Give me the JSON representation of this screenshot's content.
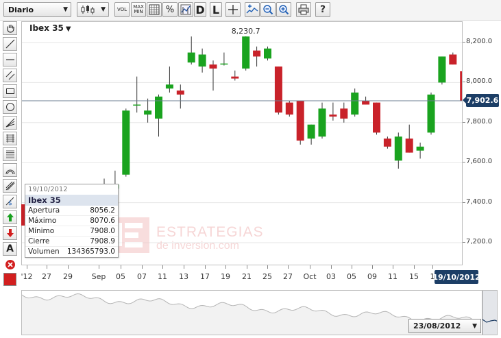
{
  "toolbar": {
    "period_label": "Diario",
    "vol_label": "VOL",
    "maxmin_label_top": "MAX",
    "maxmin_label_bottom": "MIN",
    "percent_label": "%",
    "daily_label": "D",
    "log_label": "L",
    "help_label": "?"
  },
  "chart": {
    "instrument": "Ibex 35",
    "max_label": "8,230.7",
    "current_price_tag": "7,902.6",
    "current_date_tag": "19/10/2012",
    "y_ticks": [
      "8,200.0",
      "8,000.0",
      "7,800.0",
      "7,600.0",
      "7,400.0",
      "7,200.0"
    ],
    "x_ticks": [
      "'12",
      "27",
      "29",
      "Sep",
      "05",
      "07",
      "11",
      "13",
      "17",
      "19",
      "21",
      "25",
      "27",
      "Oct",
      "03",
      "05",
      "09",
      "11",
      "15",
      "1"
    ],
    "up_color": "#1aa31f",
    "down_color": "#c9222a"
  },
  "chart_data": {
    "type": "candlestick",
    "title": "Ibex 35",
    "ylim": [
      7100,
      8300
    ],
    "y_ticks": [
      8200,
      8000,
      7800,
      7600,
      7400,
      7200
    ],
    "candles": [
      {
        "o": 7440,
        "h": 7520,
        "l": 7390,
        "c": 7460
      },
      {
        "o": 7470,
        "h": 7560,
        "l": 7420,
        "c": 7490
      },
      {
        "o": 7540,
        "h": 7870,
        "l": 7530,
        "c": 7860
      },
      {
        "o": 7885,
        "h": 8030,
        "l": 7850,
        "c": 7890
      },
      {
        "o": 7840,
        "h": 7920,
        "l": 7800,
        "c": 7860
      },
      {
        "o": 7820,
        "h": 7940,
        "l": 7730,
        "c": 7930
      },
      {
        "o": 7970,
        "h": 8080,
        "l": 7950,
        "c": 7990
      },
      {
        "o": 7960,
        "h": 7990,
        "l": 7870,
        "c": 7940
      },
      {
        "o": 8100,
        "h": 8230,
        "l": 8090,
        "c": 8150
      },
      {
        "o": 8080,
        "h": 8170,
        "l": 8050,
        "c": 8140
      },
      {
        "o": 8090,
        "h": 8110,
        "l": 7960,
        "c": 8070
      },
      {
        "o": 8090,
        "h": 8150,
        "l": 8085,
        "c": 8095
      },
      {
        "o": 8030,
        "h": 8060,
        "l": 8010,
        "c": 8020
      },
      {
        "o": 8070,
        "h": 8230.7,
        "l": 8060,
        "c": 8230
      },
      {
        "o": 8160,
        "h": 8180,
        "l": 8080,
        "c": 8130
      },
      {
        "o": 8120,
        "h": 8180,
        "l": 8110,
        "c": 8170
      },
      {
        "o": 8080,
        "h": 8080,
        "l": 7840,
        "c": 7850
      },
      {
        "o": 7900,
        "h": 7910,
        "l": 7830,
        "c": 7840
      },
      {
        "o": 7910,
        "h": 7910,
        "l": 7690,
        "c": 7710
      },
      {
        "o": 7720,
        "h": 7790,
        "l": 7690,
        "c": 7790
      },
      {
        "o": 7730,
        "h": 7900,
        "l": 7720,
        "c": 7870
      },
      {
        "o": 7840,
        "h": 7900,
        "l": 7810,
        "c": 7830
      },
      {
        "o": 7870,
        "h": 7900,
        "l": 7800,
        "c": 7820
      },
      {
        "o": 7840,
        "h": 7970,
        "l": 7830,
        "c": 7950
      },
      {
        "o": 7910,
        "h": 7930,
        "l": 7890,
        "c": 7890
      },
      {
        "o": 7900,
        "h": 7900,
        "l": 7740,
        "c": 7750
      },
      {
        "o": 7720,
        "h": 7730,
        "l": 7670,
        "c": 7680
      },
      {
        "o": 7610,
        "h": 7750,
        "l": 7570,
        "c": 7730
      },
      {
        "o": 7720,
        "h": 7790,
        "l": 7650,
        "c": 7650
      },
      {
        "o": 7660,
        "h": 7700,
        "l": 7620,
        "c": 7680
      },
      {
        "o": 7750,
        "h": 7950,
        "l": 7740,
        "c": 7940
      },
      {
        "o": 8000,
        "h": 8130,
        "l": 7990,
        "c": 8130
      },
      {
        "o": 8140,
        "h": 8150,
        "l": 8090,
        "c": 8090
      },
      {
        "o": 8056.2,
        "h": 8070.6,
        "l": 7908.0,
        "c": 7908.9
      }
    ]
  },
  "tooltip": {
    "date": "19/10/2012",
    "name": "Ibex 35",
    "rows": [
      {
        "label": "Apertura",
        "value": "8056.2"
      },
      {
        "label": "Máximo",
        "value": "8070.6"
      },
      {
        "label": "Mínimo",
        "value": "7908.0"
      },
      {
        "label": "Cierre",
        "value": "7908.9"
      },
      {
        "label": "Volumen",
        "value": "134365793.0"
      }
    ]
  },
  "watermark": {
    "line1": "ESTRATEGIAS",
    "line2": "de inversion.com"
  },
  "navigator": {
    "date": "23/08/2012"
  },
  "palette": {
    "text_tool_label": "A"
  }
}
